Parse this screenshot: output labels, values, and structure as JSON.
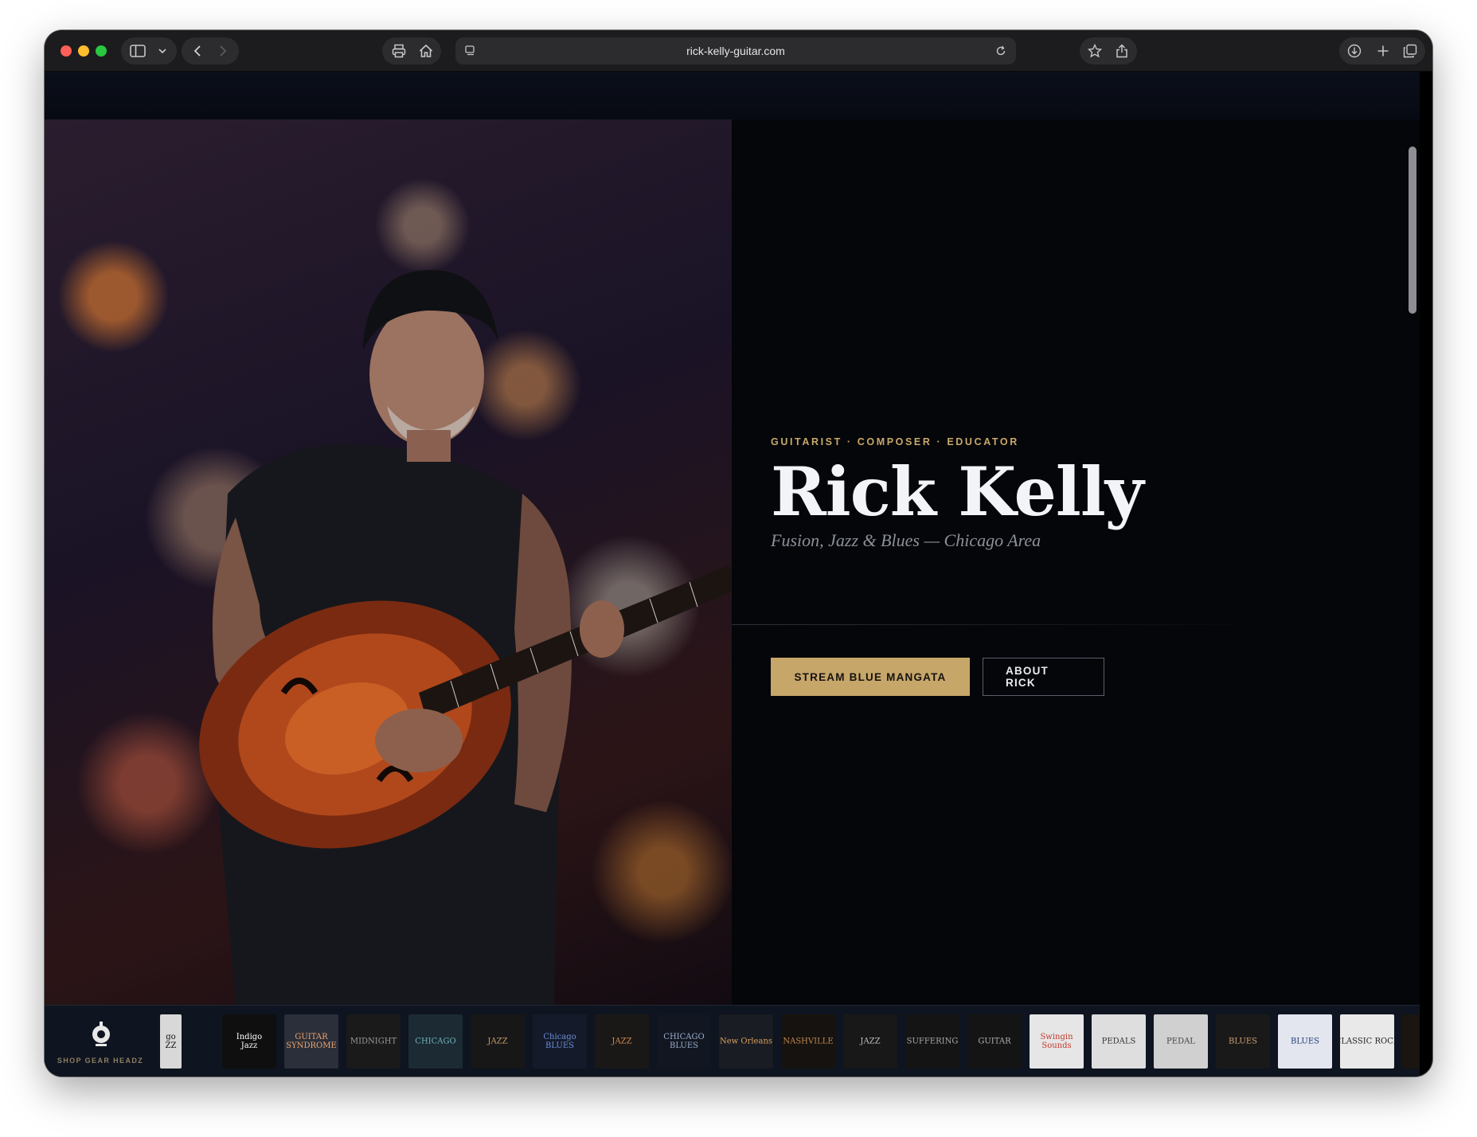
{
  "browser": {
    "url": "rick-kelly-guitar.com",
    "icons": [
      "sidebar-icon",
      "chevron-down-icon",
      "back-icon",
      "forward-icon",
      "printer-icon",
      "home-icon",
      "page-menu-icon",
      "reload-icon",
      "star-icon",
      "share-icon",
      "download-icon",
      "new-tab-icon",
      "tabs-overview-icon"
    ]
  },
  "hero": {
    "eyebrow": "GUITARIST · COMPOSER · EDUCATOR",
    "name": "Rick Kelly",
    "tagline": "Fusion, Jazz & Blues — Chicago Area",
    "primary_button": "STREAM BLUE MANGATA",
    "secondary_button": "ABOUT RICK"
  },
  "strip": {
    "logo_label": "SHOP GEAR HEADZ",
    "tiles": [
      {
        "name": "tile-jazz-partial",
        "label": "go\nZZ",
        "bg": "#d8d8d8",
        "fg": "#111111"
      },
      {
        "name": "tile-indigo-jazz",
        "label": "Indigo\nJazz",
        "bg": "#0f0f0f",
        "fg": "#ffffff"
      },
      {
        "name": "tile-guitar-syndrome",
        "label": "GUITAR\nSYNDROME",
        "bg": "#2a2f3a",
        "fg": "#f0a36a"
      },
      {
        "name": "tile-midnight-chicago",
        "label": "MIDNIGHT",
        "bg": "#1a1a1a",
        "fg": "#9a9a9a"
      },
      {
        "name": "tile-chicago-lounge",
        "label": "CHICAGO",
        "bg": "#1b2a33",
        "fg": "#6fb3b8"
      },
      {
        "name": "tile-mehr-jazz",
        "label": "JAZZ",
        "bg": "#171717",
        "fg": "#c49a6a"
      },
      {
        "name": "tile-chicago-blues-1",
        "label": "Chicago\nBLUES",
        "bg": "#151a2a",
        "fg": "#6a8fd6"
      },
      {
        "name": "tile-jazz-guitar",
        "label": "JAZZ",
        "bg": "#1a1816",
        "fg": "#d08a4a"
      },
      {
        "name": "tile-chicago-blues-2",
        "label": "CHICAGO\nBLUES",
        "bg": "#121620",
        "fg": "#9ab0d0"
      },
      {
        "name": "tile-new-orleans",
        "label": "New Orleans",
        "bg": "#191c22",
        "fg": "#d8a060"
      },
      {
        "name": "tile-nashville",
        "label": "NASHVILLE",
        "bg": "#16120f",
        "fg": "#c08850"
      },
      {
        "name": "tile-jazz-circle",
        "label": "JAZZ",
        "bg": "#181818",
        "fg": "#bfbfbf"
      },
      {
        "name": "tile-suffering",
        "label": "SUFFERING",
        "bg": "#141414",
        "fg": "#a8a8a8"
      },
      {
        "name": "tile-guitar-player",
        "label": "GUITAR",
        "bg": "#141414",
        "fg": "#b0b0b0"
      },
      {
        "name": "tile-swingin-sounds",
        "label": "Swingin\nSounds",
        "bg": "#e6e6e6",
        "fg": "#c0392b"
      },
      {
        "name": "tile-pedals-sketch",
        "label": "PEDALS",
        "bg": "#dedede",
        "fg": "#333333"
      },
      {
        "name": "tile-pedal",
        "label": "PEDAL",
        "bg": "#d0d0d0",
        "fg": "#444444"
      },
      {
        "name": "tile-skull-blues",
        "label": "BLUES",
        "bg": "#191919",
        "fg": "#d0a070"
      },
      {
        "name": "tile-blue-guitarist",
        "label": "BLUES",
        "bg": "#e3e6ee",
        "fg": "#233a7a"
      },
      {
        "name": "tile-classic-rock",
        "label": "CLASSIC ROCK",
        "bg": "#e9e9e9",
        "fg": "#222222"
      },
      {
        "name": "tile-partial-end",
        "label": "",
        "bg": "#1a1510",
        "fg": "#c98a40"
      }
    ]
  }
}
